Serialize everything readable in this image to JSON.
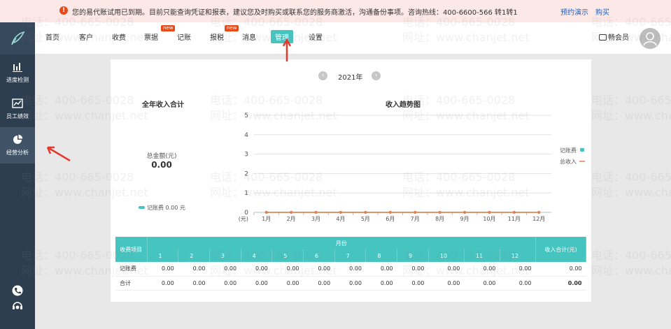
{
  "notice": {
    "message": "您的易代账试用已到期。目前只能查询凭证和报表，建议您及时购买或联系您的服务商激活，沟通备份事项。咨询热线：400-6600-566 转1转1",
    "link_demo": "预约演示",
    "link_buy": "购买"
  },
  "nav": {
    "items": [
      {
        "label": "首页"
      },
      {
        "label": "客户"
      },
      {
        "label": "收费"
      },
      {
        "label": "票据",
        "badge": "new"
      },
      {
        "label": "记账"
      },
      {
        "label": "报税",
        "badge": "new"
      },
      {
        "label": "消息"
      },
      {
        "label": "管理",
        "active": true
      },
      {
        "label": "设置"
      }
    ],
    "vip": "畅会员"
  },
  "sidebar": {
    "items": [
      {
        "label": "进度检测",
        "icon": "bar-chart-icon"
      },
      {
        "label": "员工绩效",
        "icon": "line-chart-icon"
      },
      {
        "label": "经营分析",
        "icon": "pie-chart-icon",
        "active": true
      }
    ],
    "bottom": [
      "phone-icon",
      "headset-icon"
    ]
  },
  "panel": {
    "year": "2021年",
    "left_title": "全年收入合计",
    "total_label": "总金额(元)",
    "total_value": "0.00",
    "legend": "记账费  0.00 元",
    "right_title": "收入趋势图"
  },
  "chart_data": {
    "type": "line",
    "title": "收入趋势图",
    "categories": [
      "1月",
      "2月",
      "3月",
      "4月",
      "5月",
      "6月",
      "7月",
      "8月",
      "9月",
      "10月",
      "11月",
      "12月"
    ],
    "series": [
      {
        "name": "记账费",
        "values": [
          0,
          0,
          0,
          0,
          0,
          0,
          0,
          0,
          0,
          0,
          0,
          0
        ],
        "color": "#45c4c0"
      },
      {
        "name": "总收入",
        "values": [
          0,
          0,
          0,
          0,
          0,
          0,
          0,
          0,
          0,
          0,
          0,
          0
        ],
        "color": "#f07d45"
      }
    ],
    "ylabel": "(元)",
    "ylim": [
      0,
      5
    ],
    "yticks": [
      "0",
      "1",
      "2",
      "3",
      "4",
      "5"
    ],
    "grid": true,
    "legend_position": "right"
  },
  "table": {
    "col_item": "收费项目",
    "col_month": "月份",
    "col_total": "收入合计(元)",
    "months": [
      "1",
      "2",
      "3",
      "4",
      "5",
      "6",
      "7",
      "8",
      "9",
      "10",
      "11",
      "12"
    ],
    "rows": [
      {
        "name": "记账费",
        "values": [
          "0.00",
          "0.00",
          "0.00",
          "0.00",
          "0.00",
          "0.00",
          "0.00",
          "0.00",
          "0.00",
          "0.00",
          "0.00",
          "0.00"
        ],
        "total": "0.00"
      },
      {
        "name": "合计",
        "values": [
          "0.00",
          "0.00",
          "0.00",
          "0.00",
          "0.00",
          "0.00",
          "0.00",
          "0.00",
          "0.00",
          "0.00",
          "0.00",
          "0.00"
        ],
        "total": "0.00"
      }
    ]
  },
  "watermark": {
    "phone": "电话：400-665-0028",
    "site": "网址：www.chanjet.net"
  },
  "colors": {
    "accent": "#45c4c0",
    "sidebar": "#2d3e50",
    "warn": "#e64a19",
    "line2": "#f07d45"
  }
}
